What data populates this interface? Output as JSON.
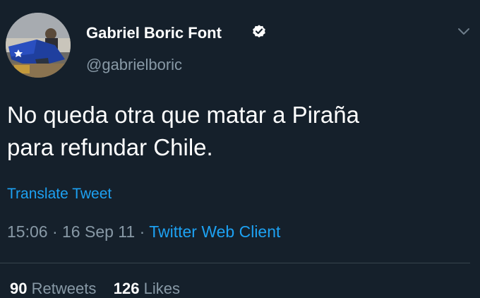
{
  "tweet": {
    "display_name": "Gabriel Boric Font",
    "handle": "@gabrielboric",
    "text_lines": [
      "No queda otra que matar a Piraña",
      "para refundar Chile."
    ],
    "translate_label": "Translate Tweet",
    "time": "15:06",
    "date": "16 Sep 11",
    "separator": " · ",
    "client": "Twitter Web Client",
    "stats": {
      "retweets_count": "90",
      "retweets_label": "Retweets",
      "likes_count": "126",
      "likes_label": "Likes"
    }
  },
  "icons": {
    "verified": "verified-badge-icon",
    "menu": "chevron-down-icon"
  },
  "colors": {
    "background": "#15202b",
    "text": "#ffffff",
    "secondary_text": "#8899a6",
    "link": "#1da1f2",
    "divider": "#38444d"
  }
}
